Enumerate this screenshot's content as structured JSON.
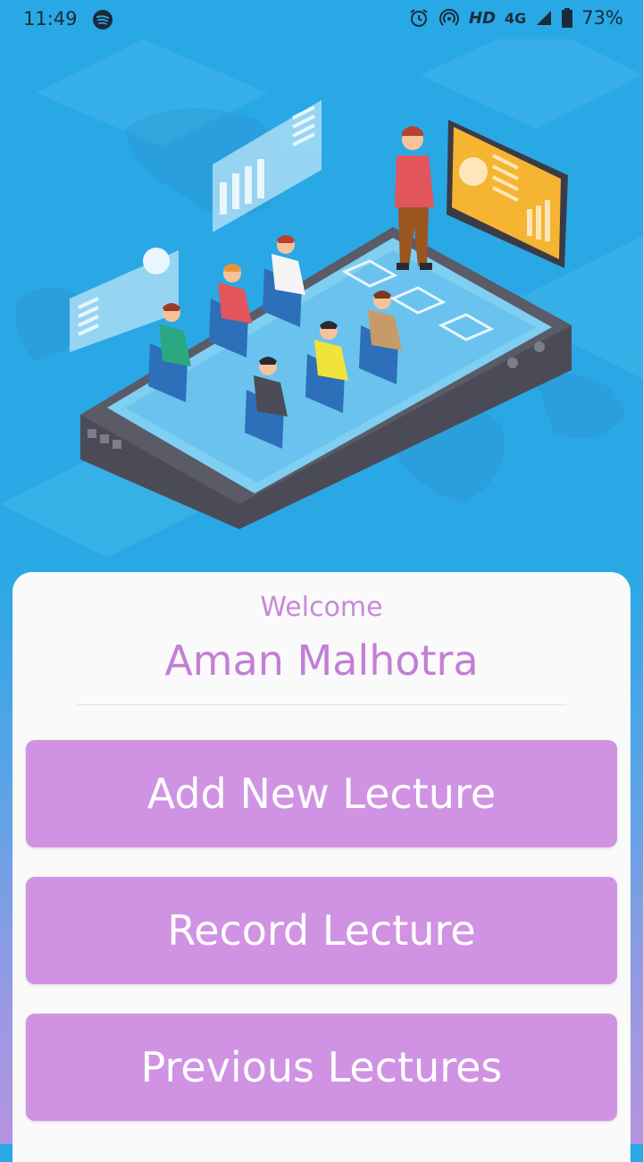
{
  "status_bar": {
    "time": "11:49",
    "network": "HD",
    "signal_type": "4G",
    "battery": "73%",
    "icons": [
      "spotify-icon",
      "alarm-icon",
      "hotspot-icon",
      "signal-icon",
      "battery-icon"
    ]
  },
  "card": {
    "welcome": "Welcome",
    "user_name": "Aman Malhotra"
  },
  "actions": {
    "add_new_lecture": "Add New Lecture",
    "record_lecture": "Record Lecture",
    "previous_lectures": "Previous Lectures"
  },
  "colors": {
    "hero_blue": "#29a8e6",
    "accent_purple": "#d092e3",
    "text_purple": "#c27fd5"
  }
}
